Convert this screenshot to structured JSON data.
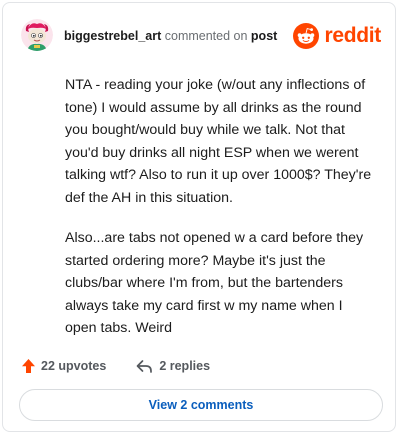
{
  "comment": {
    "username": "biggestrebel_art",
    "action_text": "commented on",
    "target_text": "post",
    "paragraphs": [
      "NTA - reading your joke (w/out any inflections of tone) I would assume by all drinks as the round you bought/would buy while we talk. Not that you'd buy drinks all night ESP when we werent talking wtf? Also to run it up over 1000$? They're def the AH in this situation.",
      "Also...are tabs not opened w a card before they started ordering more? Maybe it's just the clubs/bar where I'm from, but the bartenders always take my card first w my name when I open tabs. Weird"
    ]
  },
  "brand": {
    "wordmark": "reddit",
    "icon": "reddit-snoo-icon",
    "color": "#ff4500"
  },
  "actions": {
    "upvotes_label": "22 upvotes",
    "replies_label": "2 replies",
    "upvote_color": "#ff4500"
  },
  "footer": {
    "view_comments_label": "View 2 comments",
    "link_color": "#0a5ebd"
  }
}
